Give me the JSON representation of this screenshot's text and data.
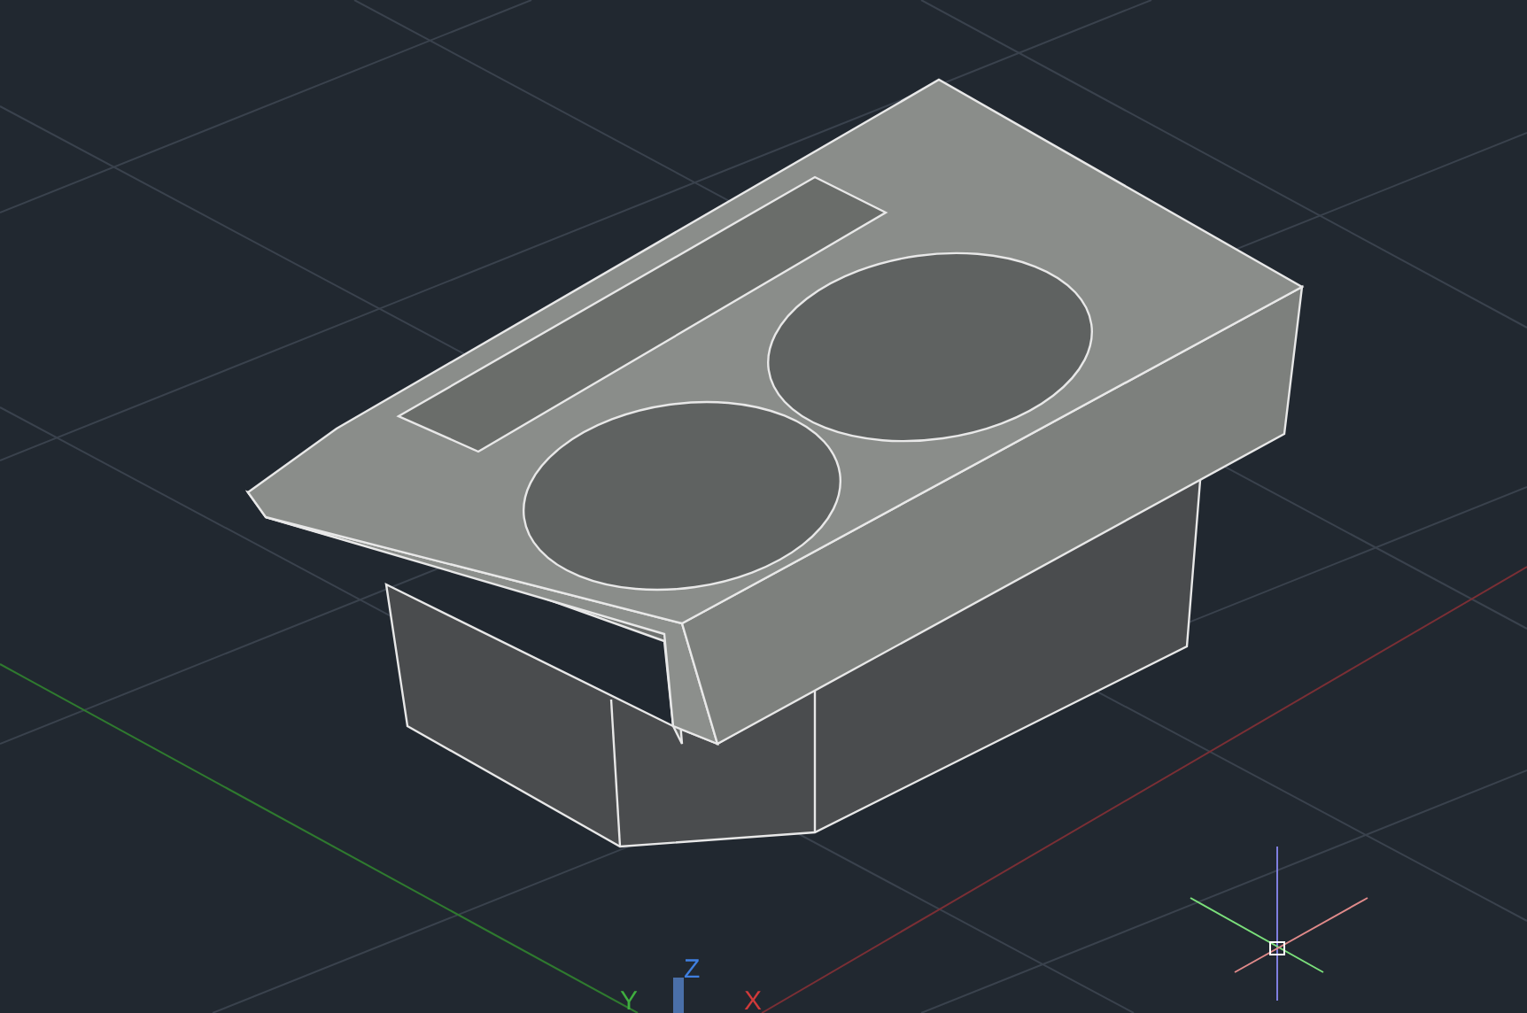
{
  "ucs_icon": {
    "labels": [
      {
        "text": "Y",
        "color": "#3fae3f"
      },
      {
        "text": "Z",
        "color": "#3f7fe0"
      },
      {
        "text": "X",
        "color": "#d03a3a"
      }
    ]
  }
}
